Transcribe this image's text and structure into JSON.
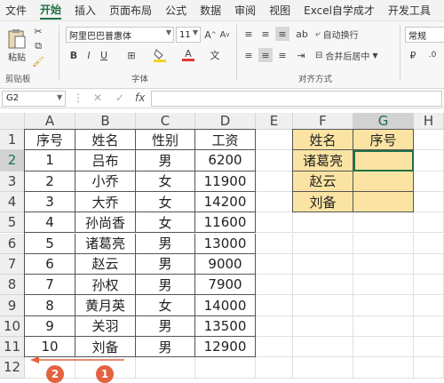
{
  "menu": [
    "文件",
    "开始",
    "插入",
    "页面布局",
    "公式",
    "数据",
    "审阅",
    "视图",
    "Excel自学成才",
    "开发工具",
    "帮助"
  ],
  "menu_active_index": 1,
  "ribbon": {
    "paste_label": "粘贴",
    "clipboard_label": "剪贴板",
    "font_name": "阿里巴巴普惠体",
    "font_size": "11",
    "font_label": "字体",
    "bold": "B",
    "italic": "I",
    "underline": "U",
    "wrap_text": "自动换行",
    "merge_center": "合并后居中",
    "align_label": "对齐方式",
    "number_format": "常规",
    "font_color": "#e03a2f",
    "fill_color": "#f5d21f"
  },
  "formula_bar": {
    "name_box": "G2",
    "fx": "fx",
    "formula": ""
  },
  "columns": [
    "A",
    "B",
    "C",
    "D",
    "E",
    "F",
    "G",
    "H"
  ],
  "rows": [
    "1",
    "2",
    "3",
    "4",
    "5",
    "6",
    "7",
    "8",
    "9",
    "10",
    "11",
    "12"
  ],
  "table": {
    "headers": [
      "序号",
      "姓名",
      "性别",
      "工资"
    ],
    "rows": [
      [
        "1",
        "吕布",
        "男",
        "6200"
      ],
      [
        "2",
        "小乔",
        "女",
        "11900"
      ],
      [
        "3",
        "大乔",
        "女",
        "14200"
      ],
      [
        "4",
        "孙尚香",
        "女",
        "11600"
      ],
      [
        "5",
        "诸葛亮",
        "男",
        "13000"
      ],
      [
        "6",
        "赵云",
        "男",
        "9000"
      ],
      [
        "7",
        "孙权",
        "男",
        "7900"
      ],
      [
        "8",
        "黄月英",
        "女",
        "14000"
      ],
      [
        "9",
        "关羽",
        "男",
        "13500"
      ],
      [
        "10",
        "刘备",
        "男",
        "12900"
      ]
    ]
  },
  "lookup": {
    "headers": [
      "姓名",
      "序号"
    ],
    "names": [
      "诸葛亮",
      "赵云",
      "刘备"
    ]
  },
  "selected_cell": "G2",
  "annotations": {
    "badge1": "1",
    "badge2": "2",
    "arrow_color": "#e3623f"
  }
}
